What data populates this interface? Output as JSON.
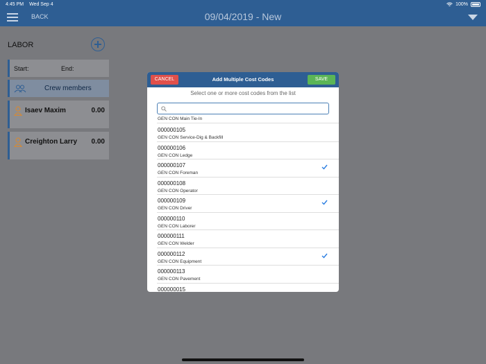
{
  "status_bar": {
    "time": "4:45 PM",
    "date": "Wed Sep 4",
    "battery": "100%"
  },
  "nav": {
    "back_label": "BACK",
    "title": "09/04/2019 - New"
  },
  "labor": {
    "title": "LABOR",
    "start_label": "Start:",
    "end_label": "End:",
    "crew_label": "Crew members",
    "people": [
      {
        "name": "Isaev Maxim",
        "hours": "0.00"
      },
      {
        "name": "Creighton Larry",
        "hours": "0.00"
      }
    ]
  },
  "modal": {
    "cancel_label": "CANCEL",
    "save_label": "SAVE",
    "title": "Add Multiple Cost Codes",
    "subtitle": "Select one or more cost codes from the list",
    "search_placeholder": "",
    "partial_item": "GEN CON Main Tie-In",
    "items": [
      {
        "code": "000000105",
        "desc": "GEN CON Service-Dig & Backfill",
        "selected": false
      },
      {
        "code": "000000106",
        "desc": "GEN CON Ledge",
        "selected": false
      },
      {
        "code": "000000107",
        "desc": "GEN CON Foreman",
        "selected": true
      },
      {
        "code": "000000108",
        "desc": "GEN CON Operator",
        "selected": false
      },
      {
        "code": "000000109",
        "desc": "GEN CON Driver",
        "selected": true
      },
      {
        "code": "000000110",
        "desc": "GEN CON Laborer",
        "selected": false
      },
      {
        "code": "000000111",
        "desc": "GEN CON Welder",
        "selected": false
      },
      {
        "code": "000000112",
        "desc": "GEN CON Equipment",
        "selected": true
      },
      {
        "code": "000000113",
        "desc": "GEN CON Pavement",
        "selected": false
      },
      {
        "code": "000000015",
        "desc": "",
        "selected": false
      }
    ]
  },
  "colors": {
    "nav": "#2e5e93",
    "cancel": "#e0504b",
    "save": "#5bb556",
    "check": "#2a7de1"
  }
}
